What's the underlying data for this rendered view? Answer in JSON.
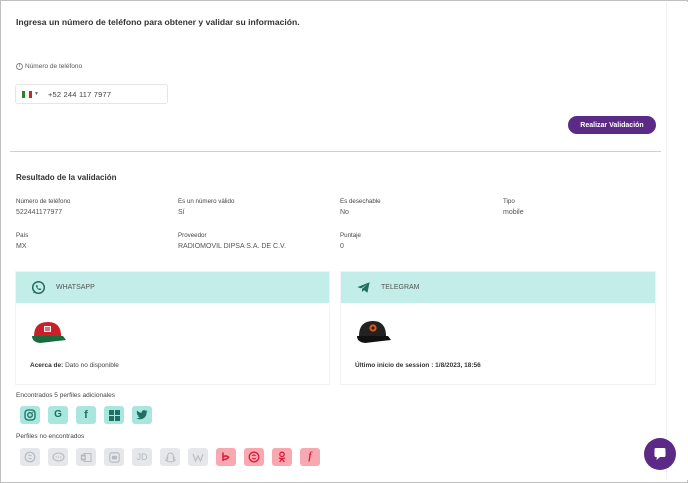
{
  "page": {
    "title": "Ingresa un número de teléfono para obtener y validar su información."
  },
  "form": {
    "phone_label": "Número de teléfono",
    "phone_value": "+52 244 117 7977",
    "country": "MX",
    "validate_button": "Realizar Validación"
  },
  "result": {
    "title": "Resultado de la validación",
    "fields": [
      {
        "label": "Número de teléfono",
        "value": "522441177977"
      },
      {
        "label": "Es un número válido",
        "value": "Sí"
      },
      {
        "label": "Es desechable",
        "value": "No"
      },
      {
        "label": "Tipo",
        "value": "mobile"
      },
      {
        "label": "País",
        "value": "MX"
      },
      {
        "label": "Proveedor",
        "value": "RADIOMOVIL DIPSA S.A. DE C.V."
      },
      {
        "label": "Puntaje",
        "value": "0"
      }
    ]
  },
  "cards": {
    "whatsapp": {
      "name": "WHATSAPP",
      "about_label": "Acerca de:",
      "about_value": "Dato no disponible",
      "icon": "whatsapp-icon",
      "color": "#c3ede8"
    },
    "telegram": {
      "name": "TELEGRAM",
      "last_session": "Último inicio de session : 1/8/2023, 18:56",
      "icon": "telegram-icon",
      "color": "#c3ede8"
    }
  },
  "profiles": {
    "found_label": "Encontrados  5 perfiles adicionales",
    "found": [
      "instagram-icon",
      "google-icon",
      "facebook-icon",
      "microsoft-icon",
      "twitter-icon"
    ],
    "not_found_label": "Perfiles no encontrados",
    "not_found": [
      "skype-icon",
      "chat-bubble-icon",
      "outlook-icon",
      "linkedin-icon",
      "jd-icon",
      "snapchat-icon",
      "wallet-icon",
      "yelp-icon",
      "skype-red-icon",
      "odnoklassniki-icon",
      "flickr-icon"
    ],
    "jd_text": "JD",
    "colors": {
      "found": "#a9e6de",
      "missing": "#e5e7eb",
      "missing_red": "#f7a8b0",
      "accent": "#5b2a86"
    }
  }
}
